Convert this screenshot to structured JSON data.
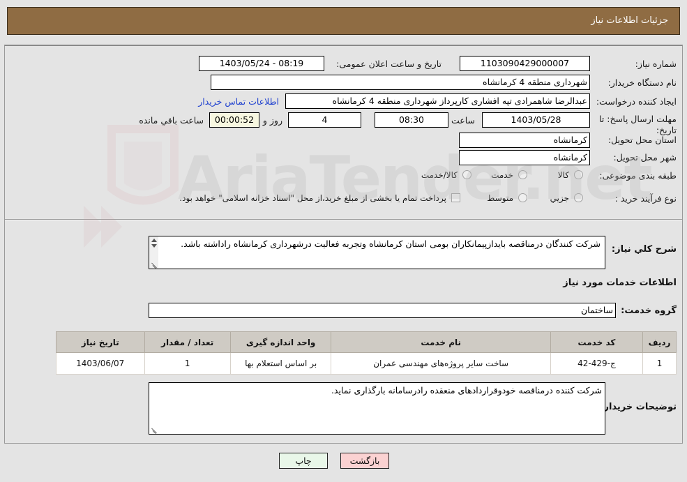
{
  "header": {
    "title": "جزئیات اطلاعات نیاز"
  },
  "form": {
    "need_number_label": "شماره نیاز:",
    "need_number_value": "1103090429000007",
    "public_announce_label": "تاریخ و ساعت اعلان عمومی:",
    "public_announce_value": "1403/05/24 - 08:19",
    "buyer_org_label": "نام دستگاه خریدار:",
    "buyer_org_value": "شهرداری منطقه 4 کرمانشاه",
    "requester_label": "ایجاد کننده درخواست:",
    "requester_value": "عبدالرضا شاهمرادی تپه افشاری کارپرداز شهرداری منطقه 4 کرمانشاه",
    "contact_link": "اطلاعات تماس خریدار",
    "deadline_label": "مهلت ارسال پاسخ: تا تاریخ:",
    "deadline_date": "1403/05/28",
    "time_label": "ساعت",
    "deadline_time": "08:30",
    "days_value": "4",
    "days_label": "روز و",
    "countdown_value": "00:00:52",
    "countdown_label": "ساعت باقي مانده",
    "province_label": "استان محل تحویل:",
    "province_value": "کرمانشاه",
    "city_label": "شهر محل تحویل:",
    "city_value": "کرمانشاه",
    "category_label": "طبقه بندی موضوعی:",
    "category_options": [
      {
        "label": "کالا",
        "selected": false
      },
      {
        "label": "خدمت",
        "selected": false
      },
      {
        "label": "کالا/خدمت",
        "selected": false
      }
    ],
    "process_label": "نوع فرآیند خرید :",
    "process_options": [
      {
        "label": "جزیي",
        "selected": false
      },
      {
        "label": "متوسط",
        "selected": false
      }
    ],
    "treasury_checkbox_label": "پرداخت تمام یا بخشی از مبلغ خرید،از محل \"اسناد خزانه اسلامی\" خواهد بود.",
    "treasury_checked": false
  },
  "general_desc": {
    "label": "شرح كلي نياز:",
    "value": "شرکت کنندگان درمناقصه بایدازپیمانکاران بومی استان کرمانشاه وتجربه فعالیت درشهرداری کرمانشاه راداشته باشد."
  },
  "services_section": {
    "title": "اطلاعات خدمات مورد نیاز",
    "group_label": "گروه خدمت:",
    "group_value": "ساختمان"
  },
  "table": {
    "columns": [
      "ردیف",
      "کد خدمت",
      "نام خدمت",
      "واحد اندازه گیری",
      "تعداد / مقدار",
      "تاریخ نیاز"
    ],
    "rows": [
      {
        "row_no": "1",
        "service_code": "ج-429-42",
        "service_name": "ساخت سایر پروژه‌های مهندسی عمران",
        "unit": "بر اساس استعلام بها",
        "quantity": "1",
        "need_date": "1403/06/07"
      }
    ]
  },
  "buyer_notes": {
    "label": "توضیحات خریدار:",
    "value": "شرکت کننده درمناقصه خودوقراردادهای منعقده رادرسامانه بارگذاری نماید."
  },
  "footer": {
    "print_label": "چاپ",
    "back_label": "بازگشت"
  },
  "colors": {
    "header_bar": "#8f6c43",
    "page_bg": "#e4e4e4",
    "link": "#1d3fcf",
    "countdown_bg": "#f7f7e0",
    "print_btn": "#e9f7e9",
    "back_btn": "#fbd2d2",
    "table_header": "#cfcbc4"
  }
}
